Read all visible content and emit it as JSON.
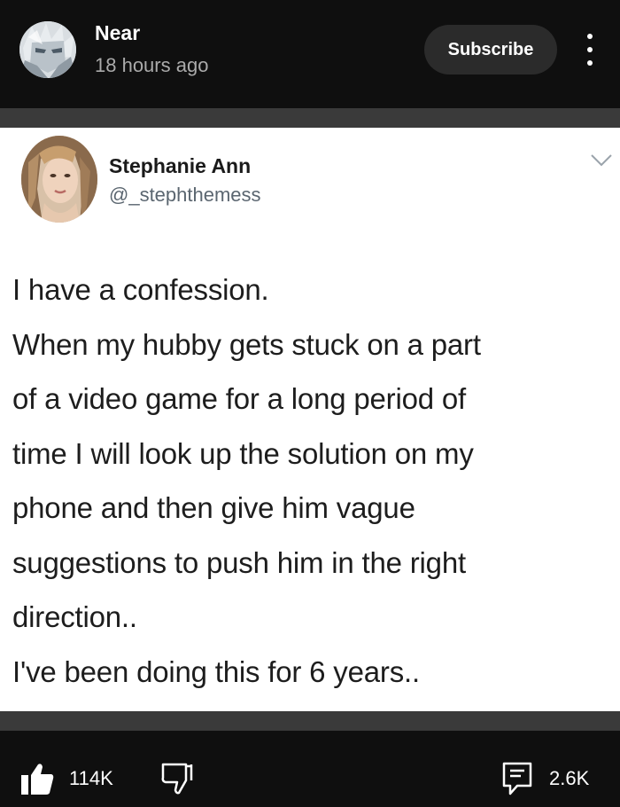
{
  "channel": {
    "name": "Near",
    "time": "18 hours ago",
    "subscribe_label": "Subscribe",
    "avatar_icon": "anime-avatar-icon"
  },
  "tweet": {
    "author_name": "Stephanie Ann",
    "handle": "@_stephthemess",
    "avatar_icon": "profile-photo",
    "lines": [
      "I have a confession.",
      "When my hubby gets stuck on a part",
      "of a video game for a long period of",
      "time I will look up the solution on my",
      "phone and then give him vague",
      "suggestions to push him in the right",
      "direction..",
      "I've been doing this for 6 years.."
    ]
  },
  "actions": {
    "like_count": "114K",
    "comment_count": "2.6K",
    "like_icon": "thumbs-up-icon",
    "dislike_icon": "thumbs-down-icon",
    "comment_icon": "comment-icon"
  },
  "colors": {
    "background": "#0f0f0f",
    "band": "#3a3a3a",
    "subscribe_bg": "#2b2b2b",
    "meta_text": "#aaaaaa",
    "card_bg": "#ffffff",
    "handle_text": "#5b6670"
  }
}
